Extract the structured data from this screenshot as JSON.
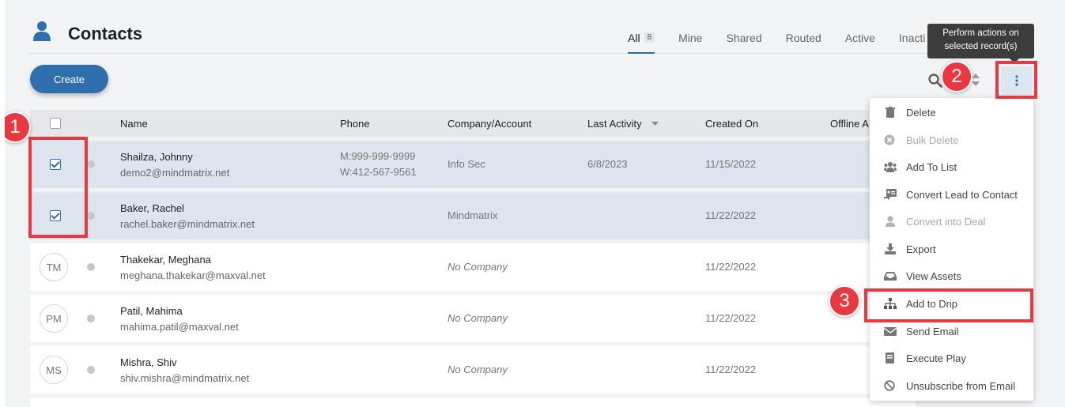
{
  "header": {
    "title": "Contacts",
    "icon": "person-icon"
  },
  "tabs": [
    {
      "label": "All",
      "badge": "8",
      "active": true
    },
    {
      "label": "Mine"
    },
    {
      "label": "Shared"
    },
    {
      "label": "Routed"
    },
    {
      "label": "Active"
    },
    {
      "label": "Inacti"
    }
  ],
  "tooltip": {
    "line1": "Perform actions on",
    "line2": "selected record(s)"
  },
  "toolbar": {
    "create_label": "Create"
  },
  "table": {
    "columns": [
      "Name",
      "Phone",
      "Company/Account",
      "Last Activity",
      "Created On",
      "Offline A"
    ],
    "rows": [
      {
        "selected": true,
        "name": "Shailza, Johnny",
        "email": "demo2@mindmatrix.net",
        "phone1": "M:999-999-9999",
        "phone2": "W:412-567-9561",
        "company": "Info Sec",
        "activity": "6/8/2023",
        "created": "11/15/2022"
      },
      {
        "selected": true,
        "name": "Baker, Rachel",
        "email": "rachel.baker@mindmatrix.net",
        "company": "Mindmatrix",
        "created": "11/22/2022"
      },
      {
        "selected": false,
        "initials": "TM",
        "name": "Thakekar, Meghana",
        "email": "meghana.thakekar@maxval.net",
        "company": "No Company",
        "created": "11/22/2022"
      },
      {
        "selected": false,
        "initials": "PM",
        "name": "Patil, Mahima",
        "email": "mahima.patil@maxval.net",
        "company": "No Company",
        "created": "11/22/2022"
      },
      {
        "selected": false,
        "initials": "MS",
        "name": "Mishra, Shiv",
        "email": "shiv.mishra@mindmatrix.net",
        "company": "No Company",
        "created": "11/22/2022"
      }
    ]
  },
  "menu": {
    "items": [
      {
        "label": "Delete",
        "icon": "trash-icon"
      },
      {
        "label": "Bulk Delete",
        "icon": "times-circle-icon",
        "disabled": true
      },
      {
        "label": "Add To List",
        "icon": "users-icon"
      },
      {
        "label": "Convert Lead to Contact",
        "icon": "convert-icon"
      },
      {
        "label": "Convert into Deal",
        "icon": "user-icon",
        "disabled": true
      },
      {
        "label": "Export",
        "icon": "download-icon"
      },
      {
        "label": "View Assets",
        "icon": "inbox-icon"
      },
      {
        "label": "Add to Drip",
        "icon": "sitemap-icon"
      },
      {
        "label": "Send Email",
        "icon": "envelope-icon"
      },
      {
        "label": "Execute Play",
        "icon": "book-icon"
      },
      {
        "label": "Unsubscribe from Email",
        "icon": "ban-icon"
      }
    ]
  },
  "annotations": {
    "step1": "1",
    "step2": "2",
    "step3": "3"
  },
  "colors": {
    "accent": "#2f6fad",
    "highlight": "#e9383f",
    "selected_row": "#dde4ed"
  }
}
